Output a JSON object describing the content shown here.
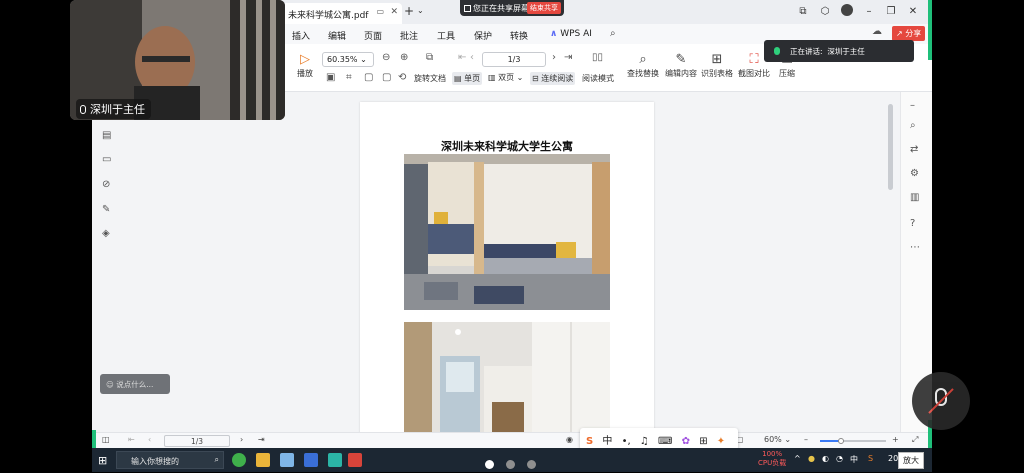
{
  "app": {
    "tab_title": "未来科学城公寓.pdf",
    "share_banner": "您正在共享屏幕",
    "end_share_label": "结束共享",
    "share_label": "分享"
  },
  "menu": {
    "items": [
      "插入",
      "编辑",
      "页面",
      "批注",
      "工具",
      "保护",
      "转换"
    ],
    "wps_ai": "WPS AI"
  },
  "toolbar": {
    "zoom_value": "60.35%",
    "page_value": "1/3",
    "play": "播放",
    "rotate": "旋转文档",
    "single_page": "单页",
    "double_page": "双页",
    "continuous": "连续阅读",
    "reading_mode": "阅读模式",
    "find_replace": "查找替换",
    "edit_content": "编辑内容",
    "recognize_table": "识别表格",
    "compare": "截图对比",
    "compress": "压缩"
  },
  "speaking": {
    "label": "正在讲话:",
    "speaker": "深圳于主任"
  },
  "webcam": {
    "name": "深圳于主任"
  },
  "document": {
    "title": "深圳未来科学城大学生公寓"
  },
  "chat": {
    "placeholder": "说点什么..."
  },
  "statusbar": {
    "page": "1/3",
    "zoom": "60%"
  },
  "taskbar": {
    "search_placeholder": "输入你想搜的",
    "cpu_percent": "100%",
    "cpu_label": "CPU负载",
    "lang": "中",
    "time_partial": "20"
  },
  "tooltip": {
    "zoom_in": "放大"
  },
  "ime": {
    "lang": "中"
  }
}
